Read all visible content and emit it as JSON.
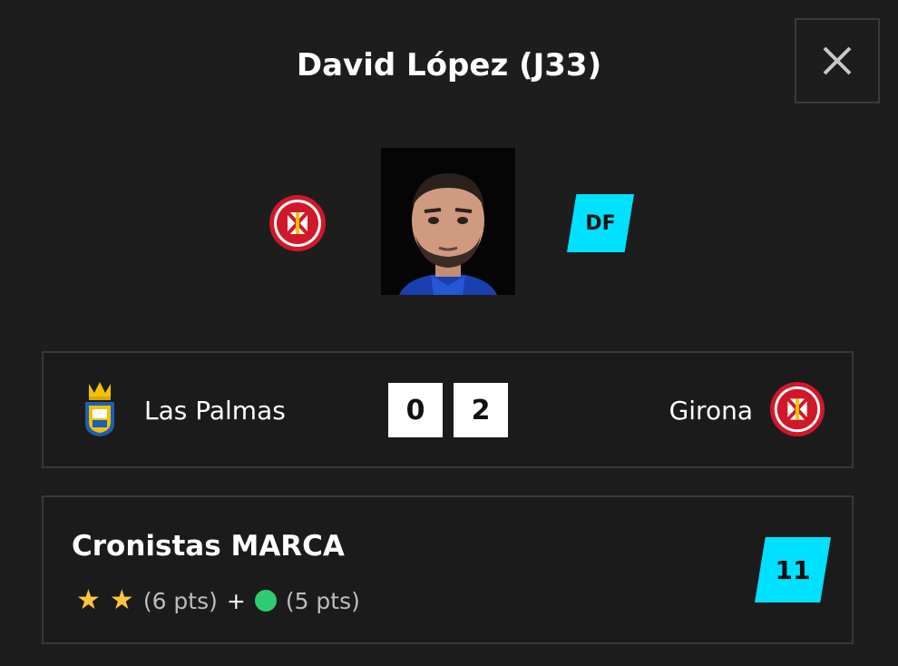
{
  "header": {
    "title": "David López (J33)",
    "close_icon": "close-icon"
  },
  "player": {
    "position": "DF",
    "team_crest": "girona-crest-icon"
  },
  "match": {
    "home_team": "Las Palmas",
    "away_team": "Girona",
    "home_score": "0",
    "away_score": "2"
  },
  "rating": {
    "source": "Cronistas MARCA",
    "stars_points": "(6 pts)",
    "plus": "+",
    "extra_points": "(5 pts)",
    "total": "11",
    "star_count": 2
  },
  "colors": {
    "accent": "#00e0ff",
    "star": "#ffc43d",
    "dot": "#2ecc71",
    "background": "#1d1d1d"
  }
}
